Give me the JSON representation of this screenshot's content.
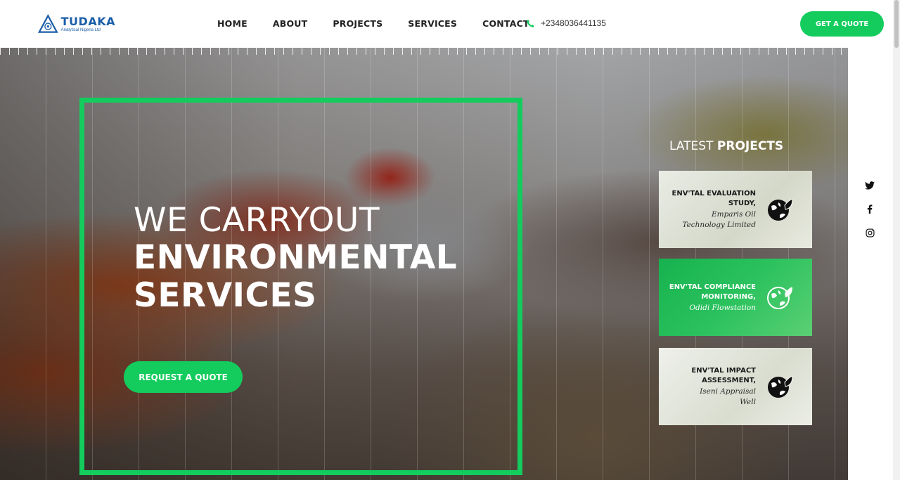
{
  "brand": {
    "name": "TUDAKA",
    "tagline": "Analytical Nigeria Ltd",
    "color": "#1b5ea8"
  },
  "nav": {
    "items": [
      "HOME",
      "ABOUT",
      "PROJECTS",
      "SERVICES",
      "CONTACT"
    ]
  },
  "contact": {
    "phone": "+2348036441135",
    "icon": "phone-icon"
  },
  "header": {
    "cta_label": "GET A QUOTE"
  },
  "hero": {
    "line1": "WE CARRYOUT",
    "line2": "ENVIRONMENTAL",
    "line3": "SERVICES",
    "cta_label": "REQUEST A QUOTE"
  },
  "projects": {
    "heading_light": "LATEST ",
    "heading_bold": "PROJECTS",
    "items": [
      {
        "title1": "ENV'TAL EVALUATION",
        "title2": "STUDY,",
        "sub1": "Emparis Oil",
        "sub2": "Technology Limited"
      },
      {
        "title1": "ENV'TAL COMPLIANCE",
        "title2": "MONITORING,",
        "sub1": "Odidi Flowstation",
        "sub2": ""
      },
      {
        "title1": "ENV'TAL IMPACT",
        "title2": "ASSESSMENT,",
        "sub1": "Iseni Appraisal",
        "sub2": "Well"
      }
    ]
  },
  "social": {
    "icons": [
      "twitter-icon",
      "facebook-icon",
      "instagram-icon"
    ]
  },
  "colors": {
    "accent": "#13cc5d"
  }
}
